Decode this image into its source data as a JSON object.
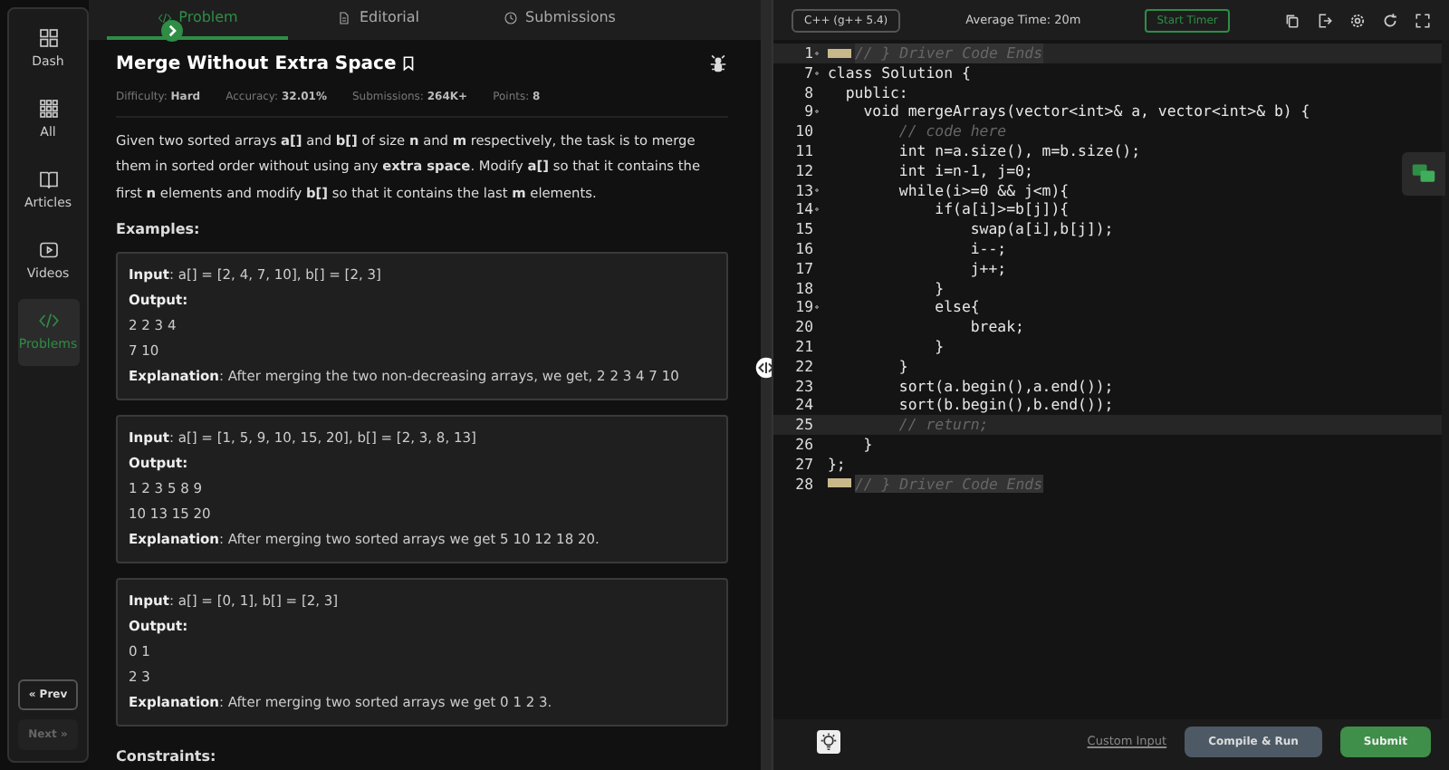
{
  "sidebar": {
    "items": [
      {
        "label": "Dash",
        "selected": false
      },
      {
        "label": "All",
        "selected": false
      },
      {
        "label": "Articles",
        "selected": false
      },
      {
        "label": "Videos",
        "selected": false
      },
      {
        "label": "Problems",
        "selected": true
      }
    ],
    "prev": "« Prev",
    "next": "Next »",
    "next_disabled": true
  },
  "tabs": [
    {
      "label": "Problem",
      "selected": true
    },
    {
      "label": "Editorial",
      "selected": false
    },
    {
      "label": "Submissions",
      "selected": false
    }
  ],
  "problem": {
    "title": "Merge Without Extra Space",
    "meta": [
      {
        "label": "Difficulty:",
        "value": "Hard"
      },
      {
        "label": "Accuracy:",
        "value": "32.01%"
      },
      {
        "label": "Submissions:",
        "value": "264K+"
      },
      {
        "label": "Points:",
        "value": "8"
      }
    ],
    "description": "Given two sorted arrays **a[]** and **b[]** of size **n** and **m** respectively, the task is to merge them in sorted order without using any **extra space**. Modify **a[]** so that it contains the first **n** elements and modify **b[]** so that it contains the last **m** elements.",
    "examples_heading": "Examples:",
    "examples": [
      {
        "input": "**Input**: a[] = [2, 4, 7, 10], b[] = [2, 3]",
        "output_label": "Output:",
        "output": [
          "2 2 3 4",
          "7 10"
        ],
        "explanation": "**Explanation**: After merging the two non-decreasing arrays, we get, 2 2 3 4 7 10"
      },
      {
        "input": "**Input**: a[] = [1, 5, 9, 10, 15, 20], b[] = [2, 3, 8, 13]",
        "output_label": "Output:",
        "output": [
          "1 2 3 5 8 9",
          "10 13 15 20"
        ],
        "explanation": "**Explanation**: After merging two sorted arrays we get 5 10 12 18 20."
      },
      {
        "input": "**Input**: a[] = [0, 1], b[] = [2, 3]",
        "output_label": "Output:",
        "output": [
          "0 1",
          "2 3"
        ],
        "explanation": "**Explanation**: After merging two sorted arrays we get 0 1 2 3."
      }
    ],
    "constraints_heading": "Constraints:"
  },
  "editor": {
    "language": "C++ (g++ 5.4)",
    "average_time": "Average Time: 20m",
    "timer": "Start Timer",
    "lines": [
      {
        "num": "1",
        "text": "// } Driver Code Ends",
        "kind": "folded",
        "foldable": true,
        "highlighted": true
      },
      {
        "num": "7",
        "text": "class Solution {",
        "kind": "code",
        "foldable": true,
        "highlighted": false
      },
      {
        "num": "8",
        "text": "  public:",
        "kind": "code",
        "foldable": false,
        "highlighted": false
      },
      {
        "num": "9",
        "text": "    void mergeArrays(vector<int>& a, vector<int>& b) {",
        "kind": "code",
        "foldable": true,
        "highlighted": false
      },
      {
        "num": "10",
        "text": "        // code here",
        "kind": "comment",
        "foldable": false,
        "highlighted": false
      },
      {
        "num": "11",
        "text": "        int n=a.size(), m=b.size();",
        "kind": "code",
        "foldable": false,
        "highlighted": false
      },
      {
        "num": "12",
        "text": "        int i=n-1, j=0;",
        "kind": "code",
        "foldable": false,
        "highlighted": false
      },
      {
        "num": "13",
        "text": "        while(i>=0 && j<m){",
        "kind": "code",
        "foldable": true,
        "highlighted": false
      },
      {
        "num": "14",
        "text": "            if(a[i]>=b[j]){",
        "kind": "code",
        "foldable": true,
        "highlighted": false
      },
      {
        "num": "15",
        "text": "                swap(a[i],b[j]);",
        "kind": "code",
        "foldable": false,
        "highlighted": false
      },
      {
        "num": "16",
        "text": "                i--;",
        "kind": "code",
        "foldable": false,
        "highlighted": false
      },
      {
        "num": "17",
        "text": "                j++;",
        "kind": "code",
        "foldable": false,
        "highlighted": false
      },
      {
        "num": "18",
        "text": "            }",
        "kind": "code",
        "foldable": false,
        "highlighted": false
      },
      {
        "num": "19",
        "text": "            else{",
        "kind": "code",
        "foldable": true,
        "highlighted": false
      },
      {
        "num": "20",
        "text": "                break;",
        "kind": "code",
        "foldable": false,
        "highlighted": false
      },
      {
        "num": "21",
        "text": "            }",
        "kind": "code",
        "foldable": false,
        "highlighted": false
      },
      {
        "num": "22",
        "text": "        }",
        "kind": "code",
        "foldable": false,
        "highlighted": false
      },
      {
        "num": "23",
        "text": "        sort(a.begin(),a.end());",
        "kind": "code",
        "foldable": false,
        "highlighted": false
      },
      {
        "num": "24",
        "text": "        sort(b.begin(),b.end());",
        "kind": "code",
        "foldable": false,
        "highlighted": false
      },
      {
        "num": "25",
        "text": "        // return;",
        "kind": "comment",
        "foldable": false,
        "highlighted": true
      },
      {
        "num": "26",
        "text": "    }",
        "kind": "code",
        "foldable": false,
        "highlighted": false
      },
      {
        "num": "27",
        "text": "};",
        "kind": "code",
        "foldable": false,
        "highlighted": false
      },
      {
        "num": "28",
        "text": "// } Driver Code Ends",
        "kind": "folded",
        "foldable": false,
        "highlighted": false
      }
    ],
    "custom_input": "Custom Input",
    "compile": "Compile & Run",
    "submit": "Submit"
  }
}
